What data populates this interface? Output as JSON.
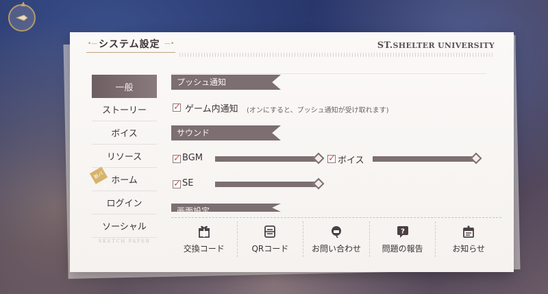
{
  "header": {
    "title": "システム設定",
    "brand_main": "ST.",
    "brand_sub": "SHELTER UNIVERSITY"
  },
  "sidebar": {
    "items": [
      {
        "label": "一般",
        "active": true
      },
      {
        "label": "ストーリー"
      },
      {
        "label": "ボイス"
      },
      {
        "label": "リソース"
      },
      {
        "label": "ホーム",
        "badge": "新パス"
      },
      {
        "label": "ログイン"
      },
      {
        "label": "ソーシャル"
      }
    ],
    "footer": "SKETCH PAPER"
  },
  "push": {
    "section_title": "プッシュ通知",
    "ingame_label": "ゲーム内通知",
    "ingame_note": "(オンにすると、プッシュ通知が受け取れます)"
  },
  "sound": {
    "section_title": "サウンド",
    "bgm_label": "BGM",
    "voice_label": "ボイス",
    "se_label": "SE",
    "bgm_level": 1.0,
    "voice_level": 1.0,
    "se_level": 1.0
  },
  "display": {
    "section_title": "画面設定"
  },
  "bottom_bar": [
    {
      "label": "交換コード",
      "icon": "gift-icon"
    },
    {
      "label": "QRコード",
      "icon": "qr-code-icon"
    },
    {
      "label": "お問い合わせ",
      "icon": "headset-icon"
    },
    {
      "label": "問題の報告",
      "icon": "report-question-icon"
    },
    {
      "label": "お知らせ",
      "icon": "notice-icon"
    }
  ],
  "colors": {
    "accent": "#7c6e71",
    "check": "#d4513e",
    "gold": "#b79a6a"
  }
}
